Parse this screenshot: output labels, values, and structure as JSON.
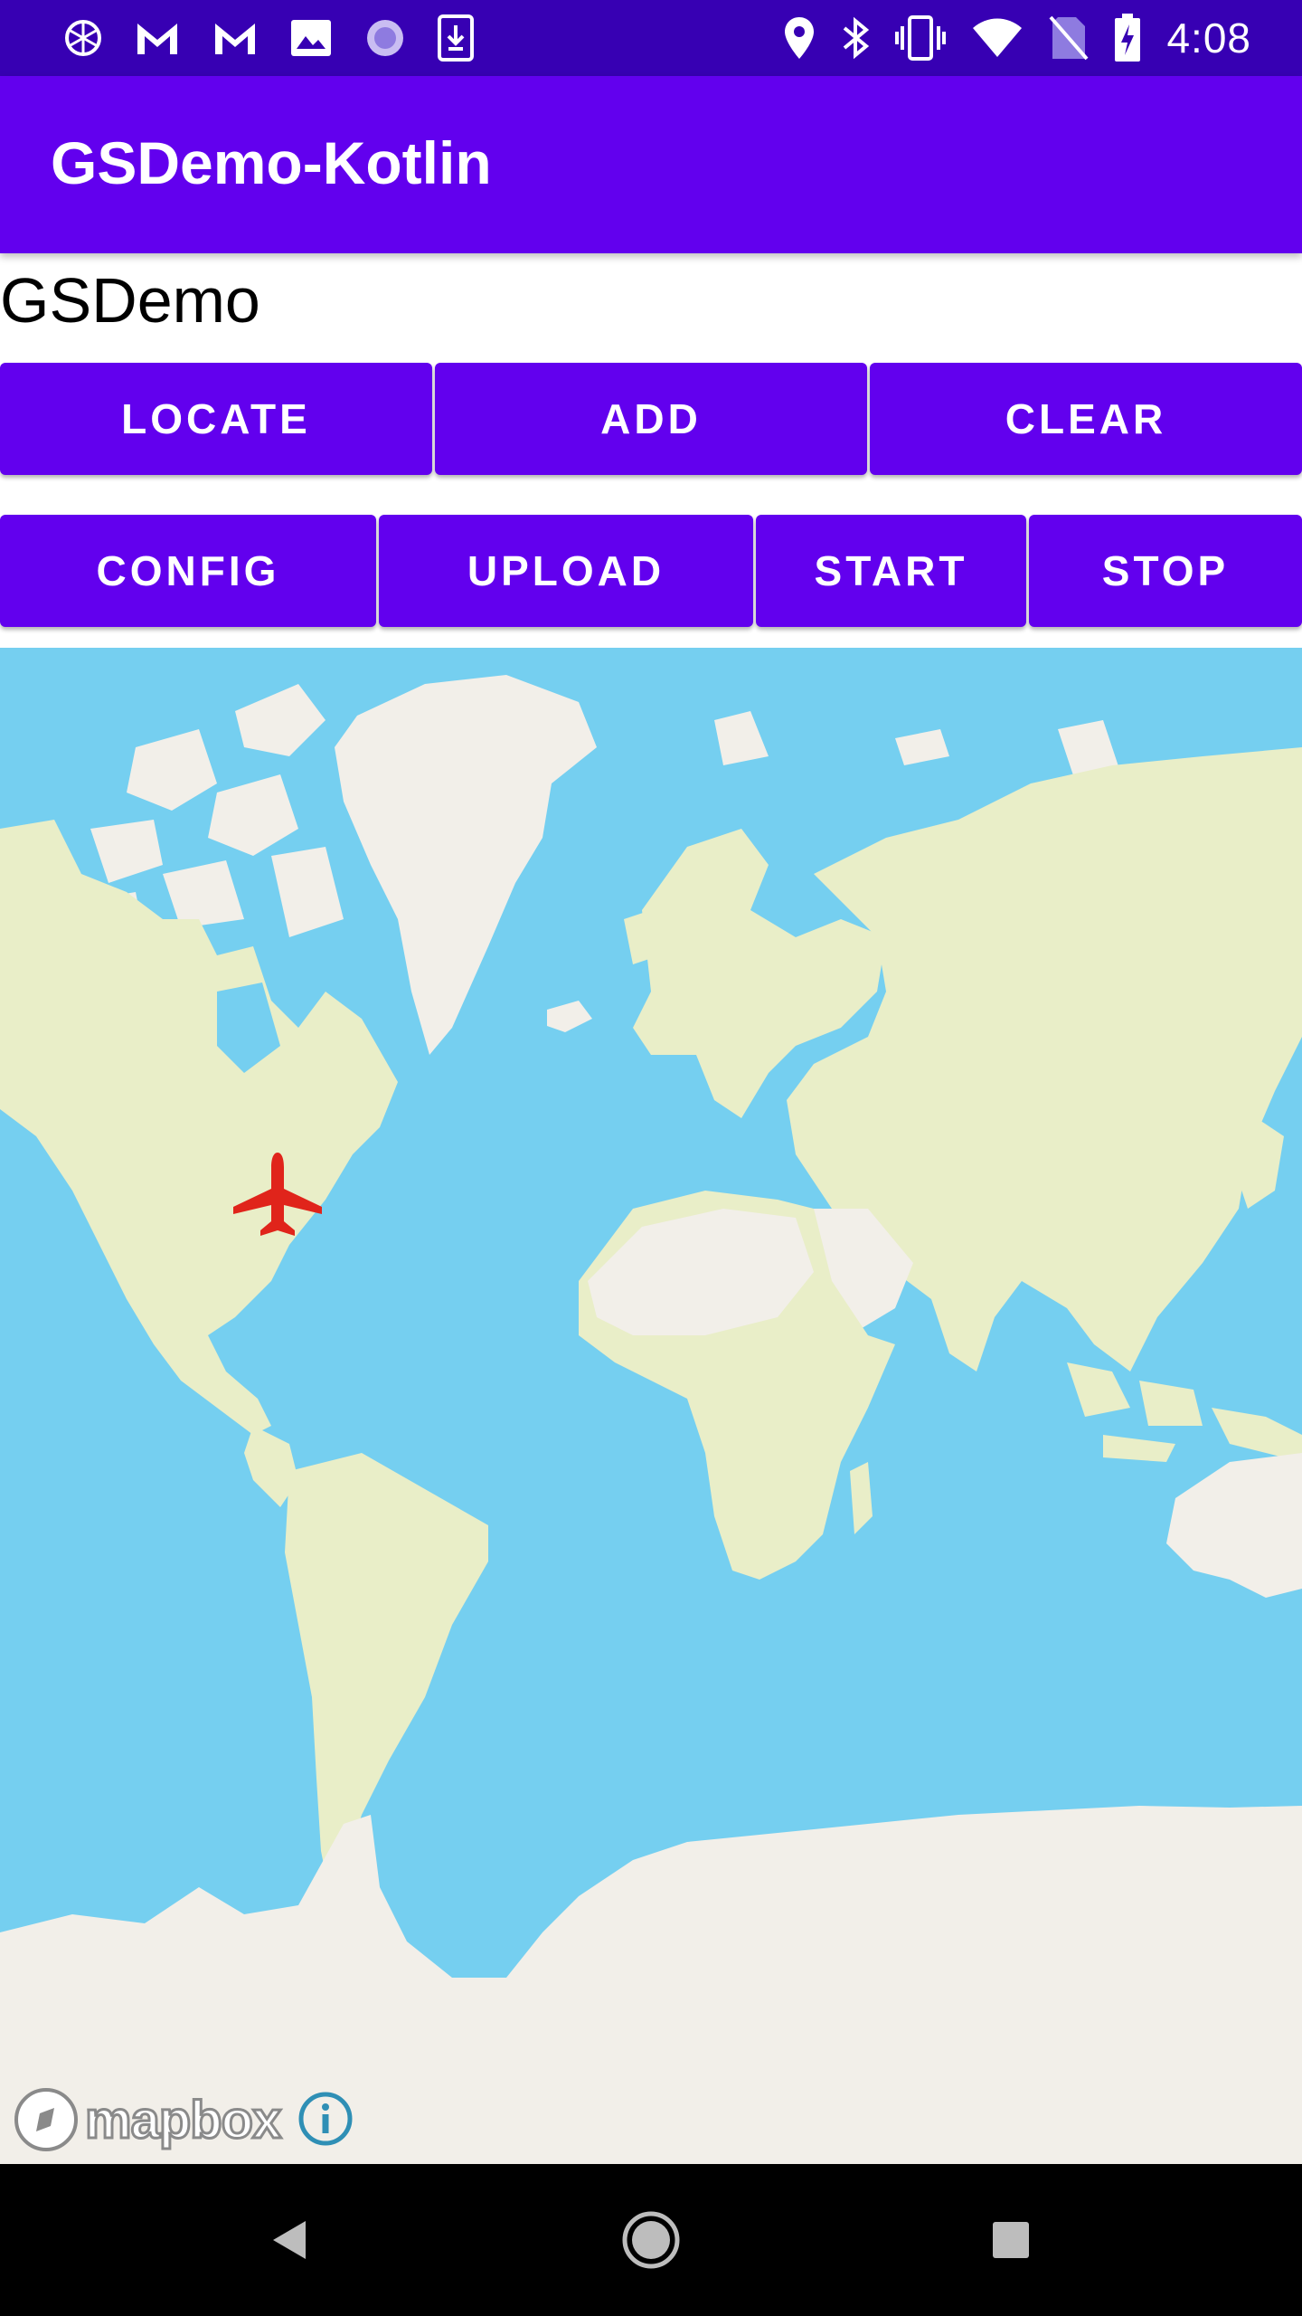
{
  "status_bar": {
    "time": "4:08",
    "left_icons": [
      "app-notification-icon",
      "gmail-icon",
      "gmail-icon",
      "image-icon",
      "sync-progress-icon",
      "download-icon"
    ],
    "right_icons": [
      "location-icon",
      "bluetooth-icon",
      "vibrate-icon",
      "wifi-icon",
      "no-sim-icon",
      "battery-charging-icon"
    ]
  },
  "app_bar": {
    "title": "GSDemo-Kotlin"
  },
  "main": {
    "label": "GSDemo",
    "row1_buttons": [
      "LOCATE",
      "ADD",
      "CLEAR"
    ],
    "row2_buttons": [
      "CONFIG",
      "UPLOAD",
      "START",
      "STOP"
    ]
  },
  "map": {
    "attribution_logo": "mapbox",
    "info_icon": "info-icon",
    "marker": "aircraft-marker-icon",
    "colors": {
      "ocean": "#75cff0",
      "land": "#e9eec8",
      "ice": "#f2efe9",
      "marker": "#e0241b"
    }
  },
  "colors": {
    "primary": "#6200ee",
    "primary_dark": "#3700b3",
    "on_primary": "#ffffff"
  },
  "nav_bar": {
    "buttons": [
      "back-icon",
      "home-icon",
      "recents-icon"
    ]
  }
}
